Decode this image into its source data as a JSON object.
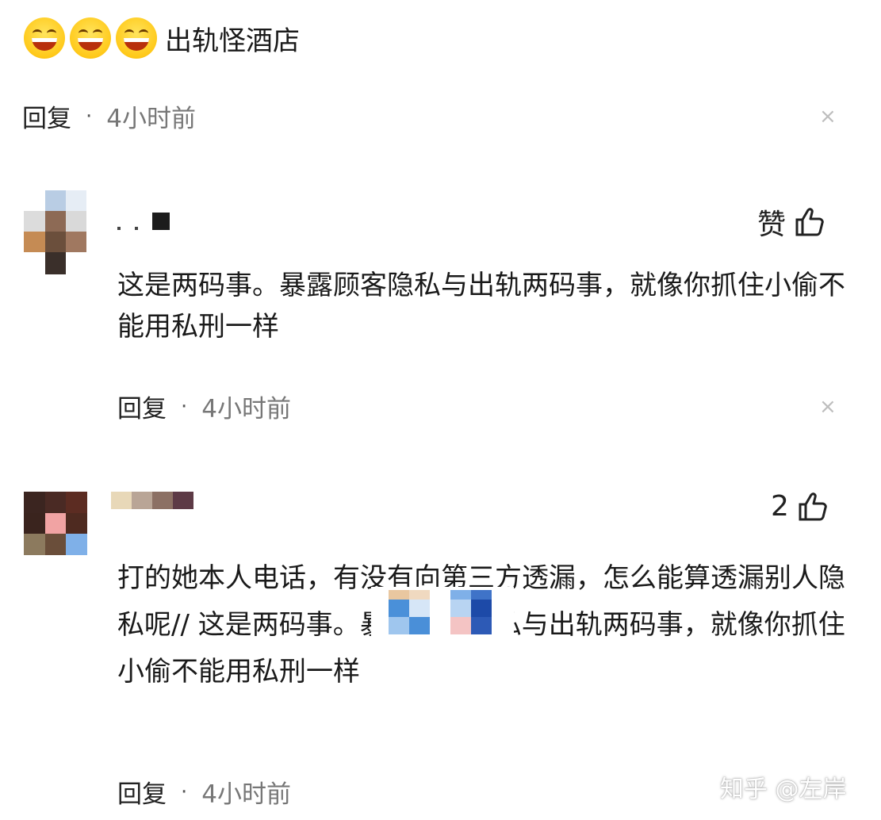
{
  "top_comment": {
    "emoji_icon": "grinning-face-icon",
    "text": "出轨怪酒店",
    "reply_label": "回复",
    "separator": "·",
    "time": "4小时前",
    "close_icon": "×"
  },
  "comments": [
    {
      "like_label": "赞",
      "like_icon": "thumbs-up-icon",
      "text": "这是两码事。暴露顾客隐私与出轨两码事，就像你抓住小偷不能用私刑一样",
      "reply_label": "回复",
      "separator": "·",
      "time": "4小时前",
      "close_icon": "×"
    },
    {
      "like_count": "2",
      "like_icon": "thumbs-up-icon",
      "text": "打的她本人电话，有没有向第三方透漏，怎么能算透漏别人隐私呢// 这是两码事。暴露顾客隐私与出轨两码事，就像你抓住小偷不能用私刑一样",
      "reply_label": "回复",
      "separator": "·",
      "time": "4小时前"
    }
  ],
  "watermark": "知乎 @左岸",
  "colors": {
    "text": "#1a1a1a",
    "muted": "#777777",
    "close": "#bdbdbd"
  }
}
